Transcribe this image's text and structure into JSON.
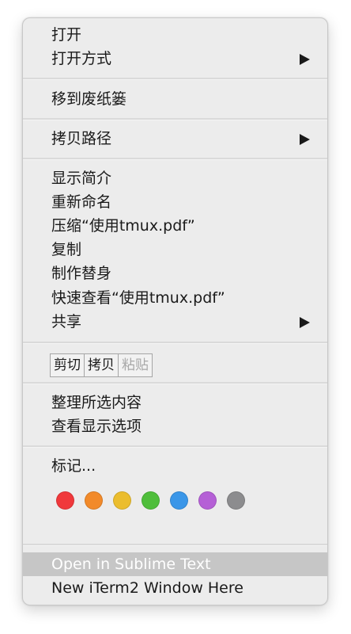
{
  "menu": {
    "open": "打开",
    "open_with": "打开方式",
    "move_to_trash": "移到废纸篓",
    "copy_path": "拷贝路径",
    "get_info": "显示简介",
    "rename": "重新命名",
    "compress": "压缩“使用tmux.pdf”",
    "duplicate": "复制",
    "make_alias": "制作替身",
    "quick_look": "快速查看“使用tmux.pdf”",
    "share": "共享",
    "edit_buttons": {
      "cut": "剪切",
      "copy": "拷贝",
      "paste": "粘贴"
    },
    "clean_up_selection": "整理所选内容",
    "show_view_options": "查看显示选项",
    "tags_label": "标记...",
    "tags": [
      {
        "name": "red",
        "color": "#f0383b"
      },
      {
        "name": "orange",
        "color": "#f28a2a"
      },
      {
        "name": "yellow",
        "color": "#ebbd2e"
      },
      {
        "name": "green",
        "color": "#4fbe3b"
      },
      {
        "name": "blue",
        "color": "#3a96e8"
      },
      {
        "name": "purple",
        "color": "#b560d6"
      },
      {
        "name": "gray",
        "color": "#8c8c8e"
      }
    ],
    "open_in_sublime": "Open in Sublime Text",
    "new_iterm_window": "New iTerm2 Window Here"
  },
  "colors": {
    "menu_background": "#ececec",
    "highlight_background": "#c6c6c6",
    "separator": "#dadada"
  }
}
